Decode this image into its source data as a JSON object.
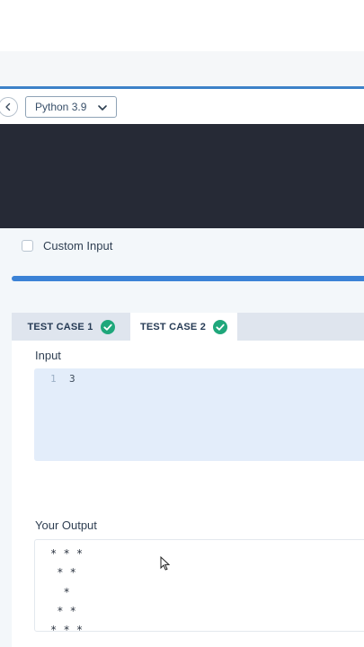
{
  "toolbar": {
    "language": "Python 3.9"
  },
  "editor": {},
  "custom_input": {
    "label": "Custom Input"
  },
  "tabs": [
    {
      "label": "TEST CASE 1",
      "passed": true
    },
    {
      "label": "TEST CASE 2",
      "passed": true
    }
  ],
  "test_panel": {
    "input_label": "Input",
    "input_line_number": "1",
    "input_value": "3",
    "output_label": "Your Output",
    "output_lines": [
      "* * *",
      " * *",
      "  *",
      " * *",
      "* * *"
    ]
  },
  "colors": {
    "accent": "#3b82d6",
    "success": "#1fa77b",
    "editor_bg": "#262a36"
  },
  "progress": {
    "fraction": 1.0
  }
}
